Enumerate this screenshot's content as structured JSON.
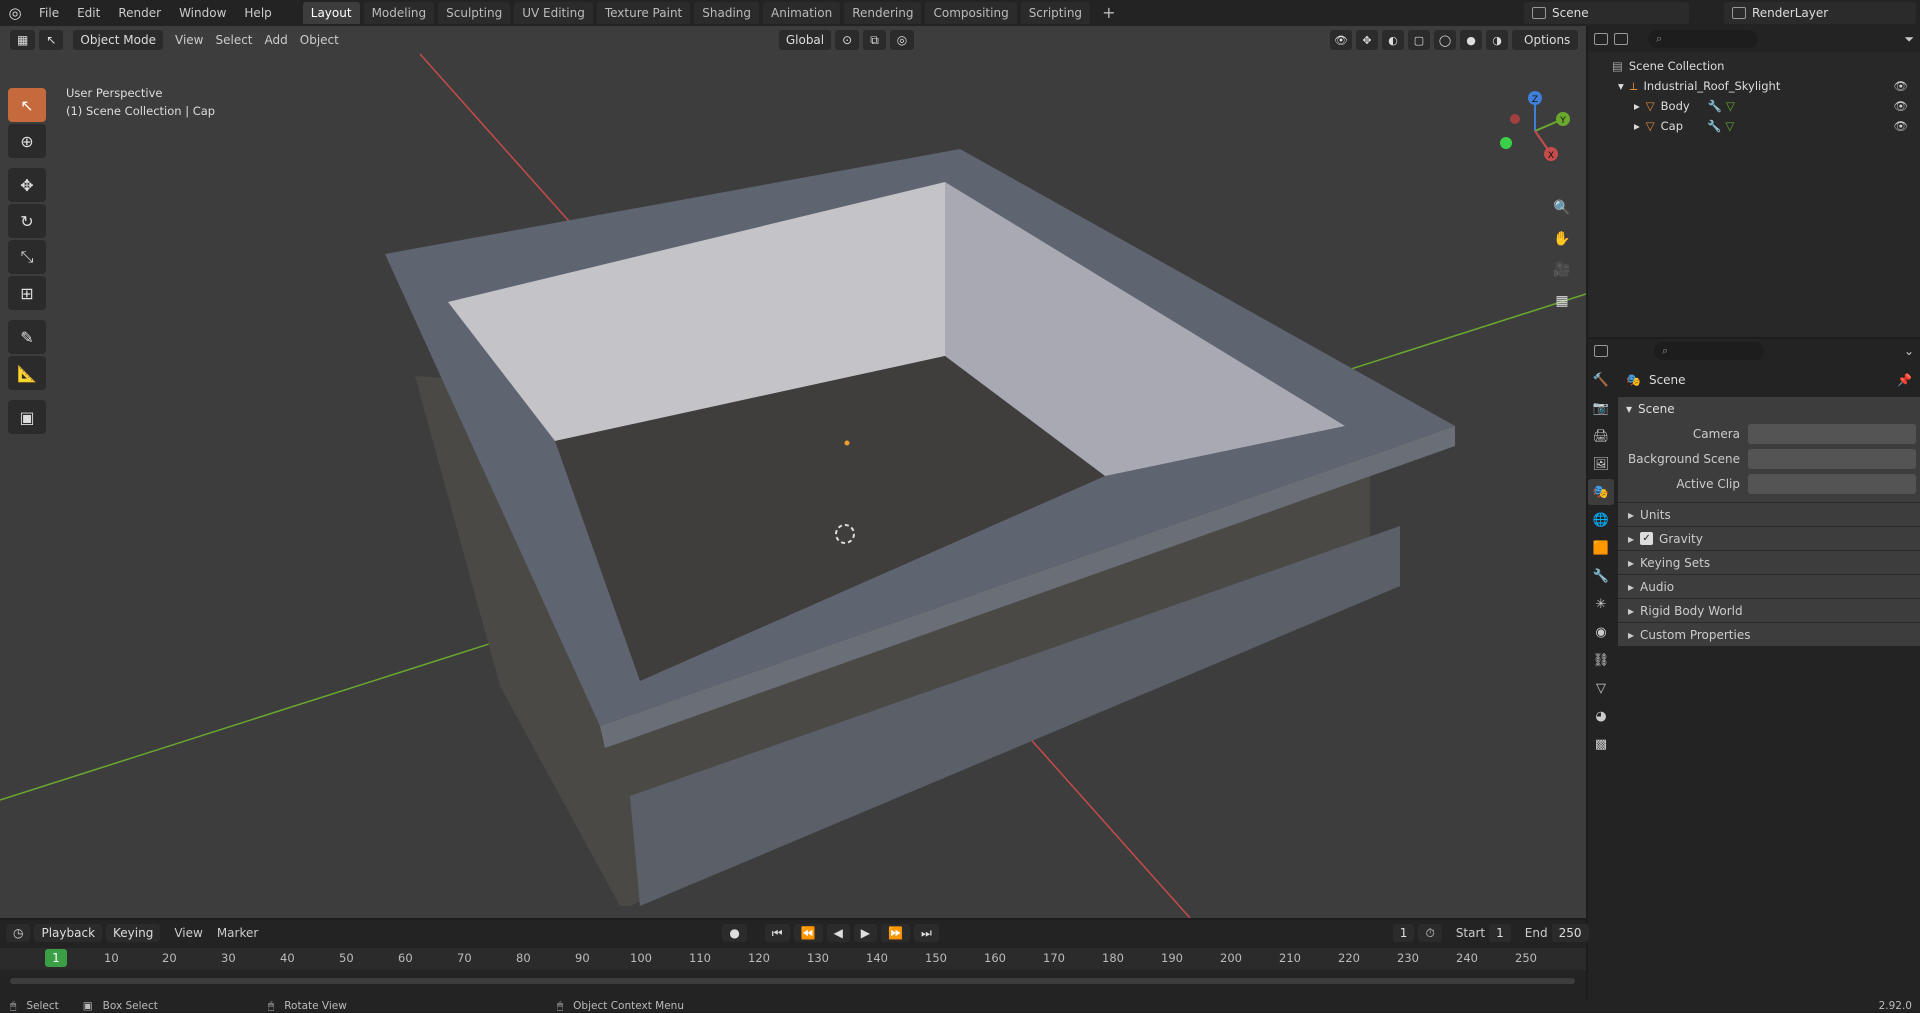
{
  "menu": [
    "File",
    "Edit",
    "Render",
    "Window",
    "Help"
  ],
  "tabs": [
    "Layout",
    "Modeling",
    "Sculpting",
    "UV Editing",
    "Texture Paint",
    "Shading",
    "Animation",
    "Rendering",
    "Compositing",
    "Scripting",
    "+"
  ],
  "scene_name": "Scene",
  "render_layer": "RenderLayer",
  "viewport": {
    "mode": "Object Mode",
    "menus": [
      "View",
      "Select",
      "Add",
      "Object"
    ],
    "transform": "Global",
    "options": "Options",
    "perspective": "User Perspective",
    "context": "(1) Scene Collection | Cap",
    "gizmo": {
      "x": "X",
      "y": "Y",
      "z": "Z"
    }
  },
  "outliner": {
    "root": "Scene Collection",
    "collection": "Industrial_Roof_Skylight",
    "objects": [
      "Body",
      "Cap"
    ]
  },
  "properties": {
    "breadcrumb": "Scene",
    "panel_title": "Scene",
    "fields": [
      "Camera",
      "Background Scene",
      "Active Clip"
    ],
    "subpanels": [
      "Units",
      "Gravity",
      "Keying Sets",
      "Audio",
      "Rigid Body World",
      "Custom Properties"
    ]
  },
  "timeline": {
    "menus": [
      "Playback",
      "Keying",
      "View",
      "Marker"
    ],
    "current_frame": "1",
    "start_label": "Start",
    "start": "1",
    "end_label": "End",
    "end": "250",
    "ticks": [
      "10",
      "20",
      "30",
      "40",
      "50",
      "60",
      "70",
      "80",
      "90",
      "100",
      "110",
      "120",
      "130",
      "140",
      "150",
      "160",
      "170",
      "180",
      "190",
      "200",
      "210",
      "220",
      "230",
      "240",
      "250"
    ]
  },
  "status": {
    "select": "Select",
    "box_select": "Box Select",
    "rotate": "Rotate View",
    "context_menu": "Object Context Menu",
    "version": "2.92.0"
  },
  "colors": {
    "accent": "#c46a3c",
    "frame": "#3ba045",
    "x_axis": "#c64b4b",
    "y_axis": "#6aa82f"
  }
}
